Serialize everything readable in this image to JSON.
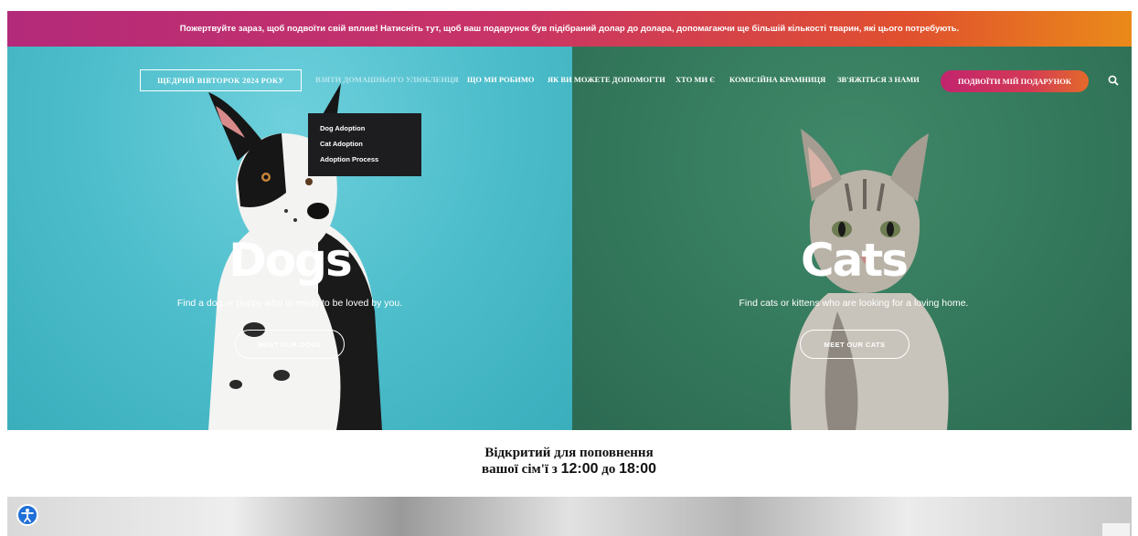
{
  "promo": {
    "text": "Пожертвуйте зараз, щоб подвоїти свій вплив! Натисніть тут, щоб ваш подарунок був підібраний долар до долара, допомагаючи ще більшій кількості тварин, які цього потребують."
  },
  "nav": {
    "gift_link": "ЩЕДРИЙ ВІВТОРОК 2024 РОКУ",
    "items": [
      "ВЗЯТИ ДОМАШНЬОГО УЛЮБЛЕНЦЯ",
      "ЩО МИ РОБИМО",
      "ЯК ВИ МОЖЕТЕ ДОПОМОГТИ",
      "ХТО МИ Є",
      "КОМІСІЙНА КРАМНИЦЯ",
      "ЗВ'ЯЖІТЬСЯ З НАМИ"
    ],
    "double_button": "ПОДВОЇТИ МІЙ ПОДАРУНОК",
    "search_icon": "search-icon"
  },
  "dropdown": {
    "items": [
      "Dog Adoption",
      "Cat Adoption",
      "Adoption Process"
    ]
  },
  "dogs": {
    "title": "Dogs",
    "subtitle": "Find a dog or puppy who is ready to be loved by you.",
    "button": "MEET OUR DOGS"
  },
  "cats": {
    "title": "Cats",
    "subtitle": "Find cats or kittens who are looking for a loving home.",
    "button": "MEET OUR CATS"
  },
  "hours": {
    "line1": "Відкритий для поповнення",
    "line2_prefix": "вашої сім'ї з",
    "open": "12:00",
    "between": "до",
    "close": "18:00"
  },
  "colors": {
    "dogs_bg": "#4bbcca",
    "cats_bg": "#33775b",
    "accent": "#c93466",
    "dropdown_bg": "#1d1d20"
  },
  "icons": [
    "search-icon",
    "accessibility-icon"
  ]
}
